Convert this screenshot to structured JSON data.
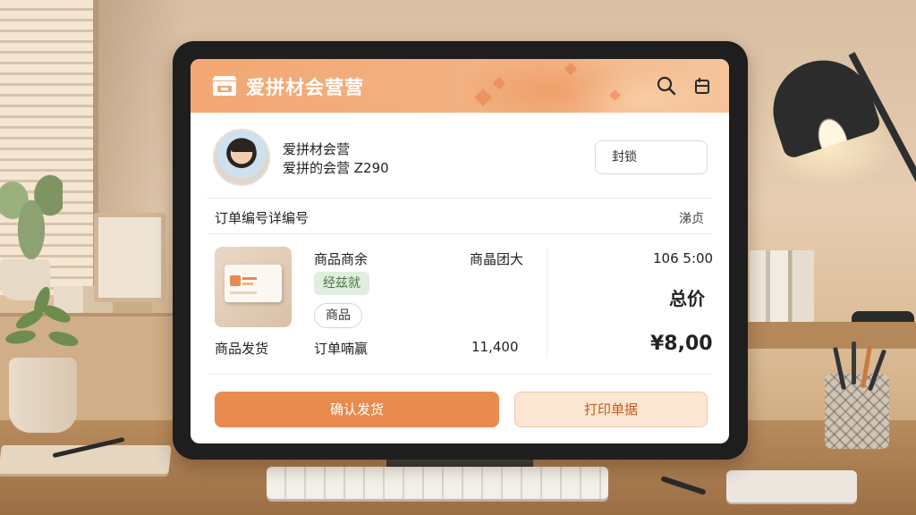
{
  "app": {
    "title": "爱拼材会营营",
    "logo_icon": "storefront-icon",
    "search_icon": "search-icon",
    "export_icon": "export-icon"
  },
  "profile": {
    "line1": "爱拼材会营",
    "line2": "爱拼的会营 Z290",
    "action_button": "封锁"
  },
  "order": {
    "title": "订单编号详编号",
    "action": "涕贞",
    "item": {
      "name": "商品商余",
      "qty_label": "商晶团大",
      "price": "106 5:00",
      "tag_green": "经兹就",
      "tag_outline": "商品",
      "ship_label": "商品发货",
      "order_label": "订单喃赢",
      "amount": "11,400"
    },
    "total_label": "总价",
    "total_price": "¥8,00"
  },
  "buttons": {
    "confirm": "确认发货",
    "print": "打印单据"
  },
  "colors": {
    "accent": "#e98a4f",
    "header_start": "#f3a773",
    "header_end": "#f5c49c",
    "tag_green_bg": "#dfeede",
    "tag_green_text": "#4e7a43",
    "secondary_bg": "#fbe6d3"
  }
}
